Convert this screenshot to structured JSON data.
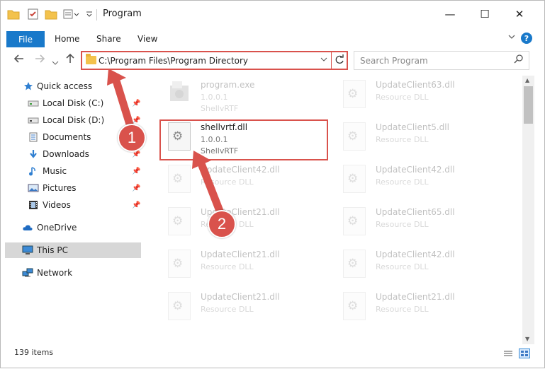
{
  "window": {
    "title": "Program",
    "controls": {
      "minimize": "—",
      "maximize": "☐",
      "close": "✕"
    }
  },
  "ribbon": {
    "tabs": [
      "File",
      "Home",
      "Share",
      "View"
    ],
    "expand_icon": "chevron-down-icon",
    "help_label": "?"
  },
  "address_bar": {
    "path": "C:\\Program Files\\Program Directory"
  },
  "search": {
    "placeholder": "Search Program"
  },
  "nav_pane": {
    "items": [
      {
        "label": "Quick access",
        "icon": "star-icon"
      },
      {
        "label": "Local Disk (C:)",
        "icon": "drive-icon",
        "pinned": true
      },
      {
        "label": "Local Disk (D:)",
        "icon": "drive-icon",
        "pinned": true
      },
      {
        "label": "Documents",
        "icon": "documents-icon",
        "pinned": true
      },
      {
        "label": "Downloads",
        "icon": "download-icon",
        "pinned": true
      },
      {
        "label": "Music",
        "icon": "music-icon",
        "pinned": true
      },
      {
        "label": "Pictures",
        "icon": "pictures-icon",
        "pinned": true
      },
      {
        "label": "Videos",
        "icon": "videos-icon",
        "pinned": true
      },
      {
        "label": "OneDrive",
        "icon": "cloud-icon"
      },
      {
        "label": "This PC",
        "icon": "computer-icon",
        "selected": true
      },
      {
        "label": "Network",
        "icon": "network-icon"
      }
    ]
  },
  "files": [
    {
      "name": "program.exe",
      "line2": "1.0.0.1",
      "line3": "ShellvRTF",
      "faded": true
    },
    {
      "name": "UpdateClient63.dll",
      "line2": "Resource DLL",
      "faded": true
    },
    {
      "name": "shellvrtf.dll",
      "line2": "1.0.0.1",
      "line3": "ShellvRTF",
      "faded": false
    },
    {
      "name": "UpdateClient5.dll",
      "line2": "Resource DLL",
      "faded": true
    },
    {
      "name": "UpdateClient42.dll",
      "line2": "Resource DLL",
      "faded": true
    },
    {
      "name": "UpdateClient42.dll",
      "line2": "Resource DLL",
      "faded": true
    },
    {
      "name": "UpdateClient21.dll",
      "line2": "Resource DLL",
      "faded": true
    },
    {
      "name": "UpdateClient65.dll",
      "line2": "Resource DLL",
      "faded": true
    },
    {
      "name": "UpdateClient21.dll",
      "line2": "Resource DLL",
      "faded": true
    },
    {
      "name": "UpdateClient42.dll",
      "line2": "Resource DLL",
      "faded": true
    },
    {
      "name": "UpdateClient21.dll",
      "line2": "Resource DLL",
      "faded": true
    },
    {
      "name": "UpdateClient21.dll",
      "line2": "Resource DLL",
      "faded": true
    }
  ],
  "annotations": {
    "badge1": "1",
    "badge2": "2",
    "color": "#d9524c"
  },
  "status_bar": {
    "item_count": "139 items"
  }
}
